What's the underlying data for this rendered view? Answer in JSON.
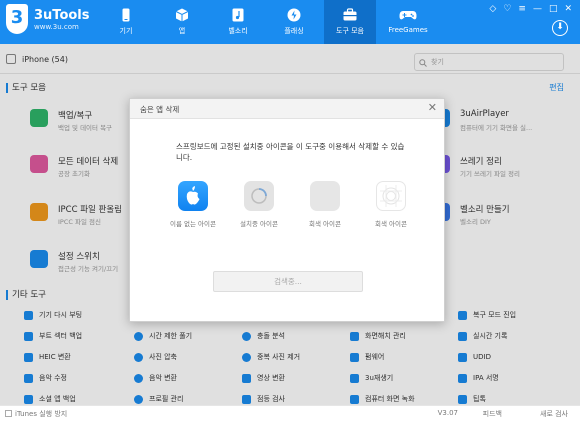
{
  "app": {
    "name": "3uTools",
    "url": "www.3u.com",
    "logo_digit": "3"
  },
  "nav": [
    {
      "label": "기기",
      "icon": "phone-icon"
    },
    {
      "label": "앱",
      "icon": "box-icon"
    },
    {
      "label": "벨소리",
      "icon": "music-file-icon"
    },
    {
      "label": "플래싱",
      "icon": "flash-icon"
    },
    {
      "label": "도구 모음",
      "icon": "toolbox-icon"
    },
    {
      "label": "FreeGames",
      "icon": "gamepad-icon"
    }
  ],
  "window_controls": [
    "◇",
    "♡",
    "≡",
    "—",
    "□",
    "✕"
  ],
  "download_icon": "⬇",
  "device": {
    "name": "iPhone (54)"
  },
  "search": {
    "placeholder": "찾기"
  },
  "toolbox": {
    "title": "도구 모음",
    "edit_label": "편집",
    "tools": [
      {
        "name": "백업/복구",
        "desc": "백업 및 데이터 복구",
        "color": "#2fb56a"
      },
      {
        "name": "모든 데이터 삭제",
        "desc": "공장 초기화",
        "color": "#e15aa0"
      },
      {
        "name": "IPCC 파일 판올림",
        "desc": "IPCC 파일 점신",
        "color": "#f29a1d"
      },
      {
        "name": "설정 스위치",
        "desc": "접근성 기능 켜기/끄기",
        "color": "#1a8cf0"
      },
      {
        "name": "3uAirPlayer",
        "desc": "컴퓨터에 기기 화면을 실...",
        "color": "#1a8cf0"
      },
      {
        "name": "쓰레기 정리",
        "desc": "기기 쓰레기 파일 정리",
        "color": "#7a5cf0"
      },
      {
        "name": "벨소리 만들기",
        "desc": "벨소리 DIY",
        "color": "#3a7af0"
      }
    ]
  },
  "other_tools": {
    "title": "기타 도구",
    "items": [
      {
        "label": "기기 다시 부팅",
        "color": "#1a8cf0"
      },
      {
        "label": "복구 모드 진입",
        "color": "#1a8cf0"
      },
      {
        "label": "부트 섹터 백업",
        "color": "#1a8cf0"
      },
      {
        "label": "시간 제한 풀기",
        "color": "#1a8cf0"
      },
      {
        "label": "충돌 분석",
        "color": "#1a8cf0"
      },
      {
        "label": "화면해치 관리",
        "color": "#1a8cf0"
      },
      {
        "label": "실시간 기록",
        "color": "#1a8cf0"
      },
      {
        "label": "HEIC 변환",
        "color": "#1a8cf0"
      },
      {
        "label": "사진 압축",
        "color": "#1a8cf0"
      },
      {
        "label": "중복 사진 제거",
        "color": "#1a8cf0"
      },
      {
        "label": "펌웨어",
        "color": "#1a8cf0"
      },
      {
        "label": "UDID",
        "color": "#1a8cf0"
      },
      {
        "label": "음악 수정",
        "color": "#1a8cf0"
      },
      {
        "label": "음악 변환",
        "color": "#1a8cf0"
      },
      {
        "label": "영상 변환",
        "color": "#1a8cf0"
      },
      {
        "label": "3u재생기",
        "color": "#1a8cf0"
      },
      {
        "label": "IPA 서명",
        "color": "#1a8cf0"
      },
      {
        "label": "소셜 앱 백업",
        "color": "#1a8cf0"
      },
      {
        "label": "프로필 관리",
        "color": "#1a8cf0"
      },
      {
        "label": "점등 검사",
        "color": "#1a8cf0"
      },
      {
        "label": "컴퓨터 화면 녹화",
        "color": "#1a8cf0"
      },
      {
        "label": "팁톡",
        "color": "#1a8cf0"
      }
    ]
  },
  "dialog": {
    "title": "숨은 앱 삭제",
    "close": "✕",
    "message": "스프링보드에 고정된 설치중 아이콘을 이 도구중 이용해서 삭제할 수 있습니다.",
    "icons": [
      {
        "label": "이름 없는 아이콘",
        "style": "apple"
      },
      {
        "label": "설치중 아이콘",
        "style": "loading"
      },
      {
        "label": "회색 아이콘",
        "style": "gray"
      },
      {
        "label": "회색 아이콘",
        "style": "grid"
      }
    ],
    "button_label": "검색중..."
  },
  "status": {
    "itunes_label": "iTunes 실행 방지",
    "version": "V3.07",
    "feedback": "피드백",
    "update": "새로 검사"
  }
}
